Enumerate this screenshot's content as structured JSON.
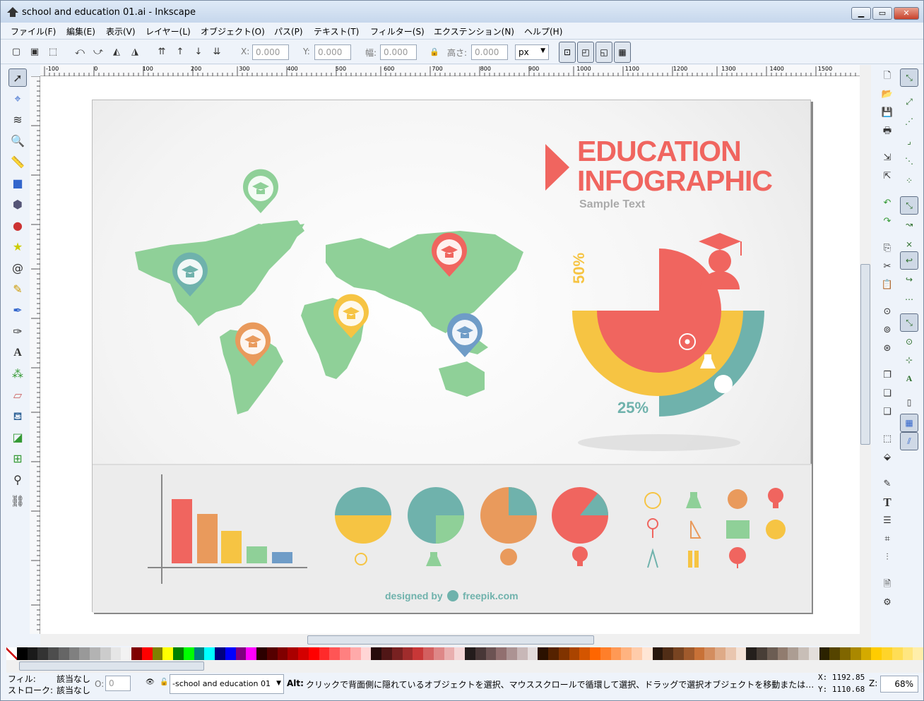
{
  "window": {
    "title": "school and education 01.ai - Inkscape",
    "min": "▁",
    "max": "▭",
    "close": "✕"
  },
  "menu": [
    "ファイル(F)",
    "編集(E)",
    "表示(V)",
    "レイヤー(L)",
    "オブジェクト(O)",
    "パス(P)",
    "テキスト(T)",
    "フィルター(S)",
    "エクステンション(N)",
    "ヘルプ(H)"
  ],
  "toolbar": {
    "x_label": "X:",
    "x_value": "0.000",
    "y_label": "Y:",
    "y_value": "0.000",
    "w_label": "幅:",
    "w_value": "0.000",
    "h_label": "高さ:",
    "h_value": "0.000",
    "unit": "px"
  },
  "ruler_h": [
    "-100",
    "0",
    "100",
    "200",
    "300",
    "400",
    "500",
    "600",
    "700",
    "800",
    "900",
    "1000",
    "1100",
    "1200",
    "1300",
    "1400",
    "1500"
  ],
  "infographic": {
    "title1": "EDUCATION",
    "title2": "INFOGRAPHIC",
    "subtitle": "Sample Text",
    "pct50": "50%",
    "pct25": "25%",
    "credit": "designed by",
    "credit_site": "freepik.com"
  },
  "colors": {
    "red": "#f0655f",
    "orange": "#e99a5c",
    "yellow": "#f6c443",
    "green": "#8fd098",
    "teal": "#6fb2ac",
    "blue": "#6f9cc7"
  },
  "status": {
    "fill_label": "フィル:",
    "fill_value": "該当なし",
    "stroke_label": "ストローク:",
    "stroke_value": "該当なし",
    "opacity_label": "O:",
    "opacity_value": "0",
    "layer": "-school and education 01",
    "message_key": "Alt:",
    "message": "クリックで背面側に隠れているオブジェクトを選択、マウススクロールで循環して選択、ドラッグで選択オブジェクトを移動または…",
    "x_coord": "X: 1192.85",
    "y_coord": "Y: 1110.68",
    "zoom_label": "Z:",
    "zoom": "68%"
  }
}
